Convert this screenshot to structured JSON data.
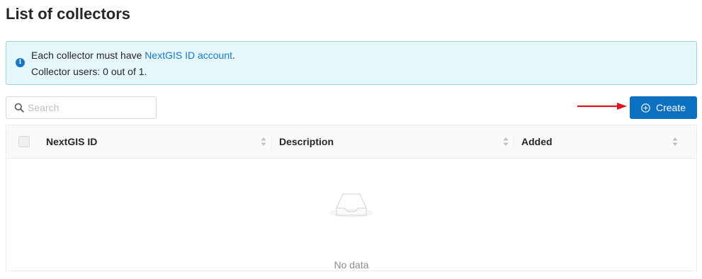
{
  "page": {
    "title": "List of collectors"
  },
  "alert": {
    "line1_prefix": "Each collector must have ",
    "line1_link": "NextGIS ID account",
    "line1_suffix": ".",
    "line2": "Collector users: 0 out of 1.",
    "icon": "info-circle-icon"
  },
  "search": {
    "placeholder": "Search",
    "value": "",
    "icon": "search-icon"
  },
  "toolbar": {
    "create_label": "Create",
    "create_icon": "plus-circle-icon"
  },
  "table": {
    "columns": [
      {
        "label": "NextGIS ID"
      },
      {
        "label": "Description"
      },
      {
        "label": "Added"
      }
    ],
    "rows": [],
    "empty_text": "No data"
  },
  "colors": {
    "primary": "#0c70c0",
    "link": "#1677c9",
    "alert_bg": "#e6f7fc",
    "alert_border": "#91d5e8",
    "annotation_arrow": "#e0141e"
  }
}
